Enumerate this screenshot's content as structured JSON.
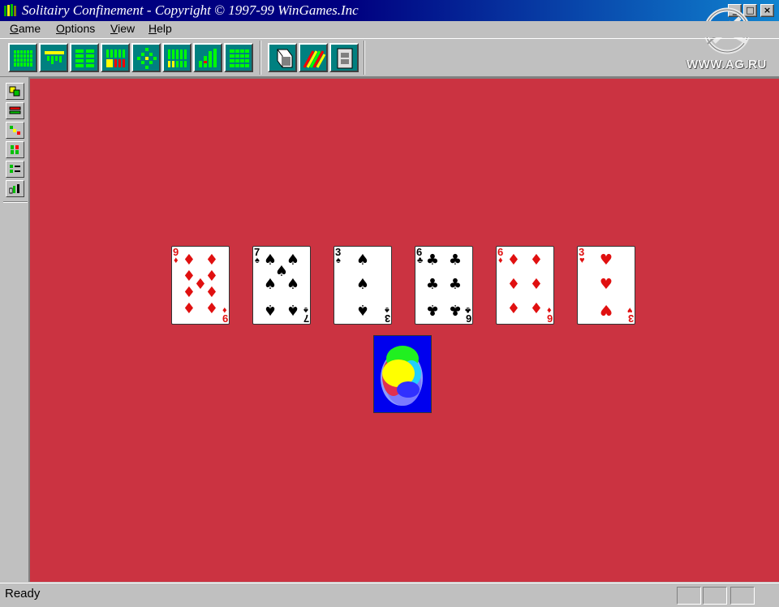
{
  "window": {
    "title": "Solitairy Confinement - Copyright © 1997-99 WinGames.Inc",
    "buttons": [
      "minimize",
      "maximize",
      "close"
    ]
  },
  "watermark": {
    "text": "WWW.AG.RU"
  },
  "menu": {
    "items": [
      {
        "label": "Game",
        "accel": "G"
      },
      {
        "label": "Options",
        "accel": "O"
      },
      {
        "label": "View",
        "accel": "V"
      },
      {
        "label": "Help",
        "accel": "H"
      }
    ]
  },
  "toolbar": {
    "layout_buttons": [
      "layout-1",
      "layout-2",
      "layout-3",
      "layout-4",
      "layout-5",
      "layout-6",
      "layout-7",
      "layout-8"
    ],
    "action_buttons": [
      "deal-icon",
      "cards-fan-icon",
      "card-back-icon"
    ]
  },
  "sidebar": {
    "buttons": [
      "sort-icon",
      "rows-icon",
      "connect-icon",
      "columns-icon",
      "list-icon",
      "stats-icon"
    ]
  },
  "tableau": {
    "cards": [
      {
        "rank": "9",
        "suit": "♦",
        "color": "red"
      },
      {
        "rank": "7",
        "suit": "♠",
        "color": "black"
      },
      {
        "rank": "3",
        "suit": "♠",
        "color": "black"
      },
      {
        "rank": "6",
        "suit": "♣",
        "color": "black"
      },
      {
        "rank": "6",
        "suit": "♦",
        "color": "red"
      },
      {
        "rank": "3",
        "suit": "♥",
        "color": "red"
      }
    ],
    "stock": {
      "face": "down"
    }
  },
  "colors": {
    "felt": "#cb3341",
    "title_bar": "#000080",
    "card_back": "#0000ee",
    "toolbar_button": "#008080"
  },
  "status": {
    "text": "Ready"
  }
}
